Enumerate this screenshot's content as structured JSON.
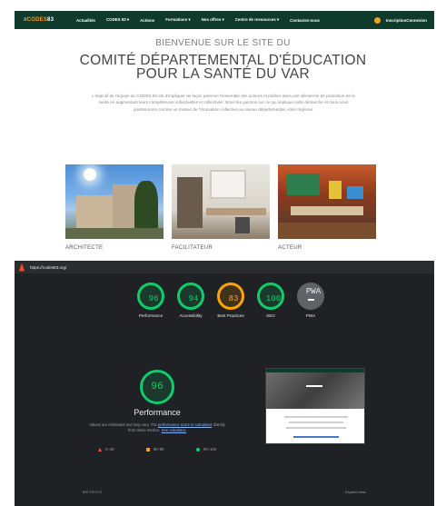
{
  "site": {
    "logo": {
      "prefix": "≡",
      "brand": "CODES",
      "suffix": "83"
    },
    "nav": [
      "Actualités",
      "CODES 83 ▾",
      "Actions",
      "Formations ▾",
      "Nos offres ▾",
      "Centre de ressources ▾",
      "Contactez-nous"
    ],
    "user_label": "InscriptionConnexion",
    "welcome": "BIENVENUE SUR LE SITE DU",
    "title_line1": "COMITÉ DÉPARTEMENTAL D'ÉDUCATION",
    "title_line2": "POUR LA SANTÉ DU VAR",
    "intro": "L'objectif de l'équipe du CODES 83 est d'impliquer de façon pérenne l'ensemble des acteurs et publics dans une démarche de promotion de la santé en augmentant leurs compétences individuelles et collectives. Nous les guidons sur ce qui implique cette démarche et nous nous positionnons comme un moteur de l'innovation collective au niveau départemental, voire régional.",
    "cards": [
      {
        "caption": "ARCHITECTE"
      },
      {
        "caption": "FACILITATEUR"
      },
      {
        "caption": "ACTEUR"
      }
    ]
  },
  "lighthouse": {
    "url": "https://codes83.org/",
    "scores": [
      {
        "value": "96",
        "label": "Performance",
        "status": "green"
      },
      {
        "value": "94",
        "label": "Accessibility",
        "status": "green"
      },
      {
        "value": "83",
        "label": "Best Practices",
        "status": "orange"
      },
      {
        "value": "100",
        "label": "SEO",
        "status": "green"
      },
      {
        "value": "PWA",
        "label": "PWA",
        "status": "gray"
      }
    ],
    "performance": {
      "value": "96",
      "title": "Performance",
      "note_before": "Values are estimated and may vary. The",
      "note_link1": "performance score is calculated",
      "note_middle": "directly from these metrics.",
      "note_link2": "See calculator."
    },
    "legend": [
      {
        "shape": "triangle",
        "range": "0–49",
        "color": "#ff4e42"
      },
      {
        "shape": "square",
        "range": "50–89",
        "color": "#ffa400"
      },
      {
        "shape": "circle",
        "range": "90–100",
        "color": "#0cce6b"
      }
    ],
    "metrics_label": "METRICS",
    "expand_label": "Expand view"
  },
  "colors": {
    "nav_bg": "#0e3b2c",
    "brand_orange": "#f4a11b",
    "lh_bg": "#202124",
    "pass": "#0cce6b",
    "average": "#ffa400",
    "fail": "#ff4e42"
  }
}
